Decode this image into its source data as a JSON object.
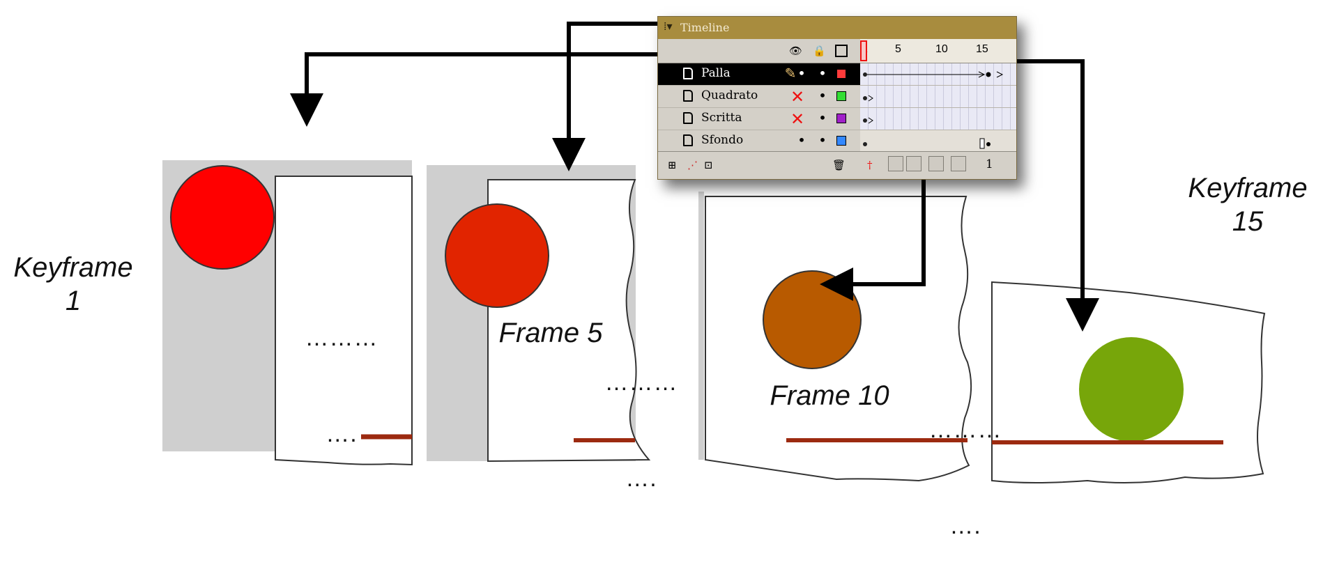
{
  "labels": {
    "keyframe1": [
      "Keyframe",
      "1"
    ],
    "frame5": "Frame 5",
    "frame10": "Frame 10",
    "keyframe15": [
      "Keyframe",
      "15"
    ]
  },
  "ellipsis": {
    "a": [
      "………",
      "…."
    ],
    "b": [
      "………",
      "…."
    ],
    "c": [
      "………",
      "…."
    ]
  },
  "timeline": {
    "title": "Timeline",
    "ruler": [
      "1",
      "5",
      "10",
      "15"
    ],
    "layers": [
      {
        "name": "Palla",
        "selected": true,
        "color": "#ff3b3b",
        "eye": "edit",
        "lock": "•"
      },
      {
        "name": "Quadrato",
        "selected": false,
        "color": "#33dd33",
        "eye": "hidden",
        "lock": "•"
      },
      {
        "name": "Scritta",
        "selected": false,
        "color": "#a020c8",
        "eye": "hidden",
        "lock": "•"
      },
      {
        "name": "Sfondo",
        "selected": false,
        "color": "#3388ff",
        "eye": "•",
        "lock": "•"
      }
    ],
    "frame_counter": "1"
  },
  "colors": {
    "ball_frame1": "#ff0000",
    "ball_frame5": "#e12400",
    "ball_frame10": "#b85a00",
    "ball_frame15": "#77a60a",
    "ground": "#9c2a10",
    "stage_grey": "#cfcfcf"
  }
}
